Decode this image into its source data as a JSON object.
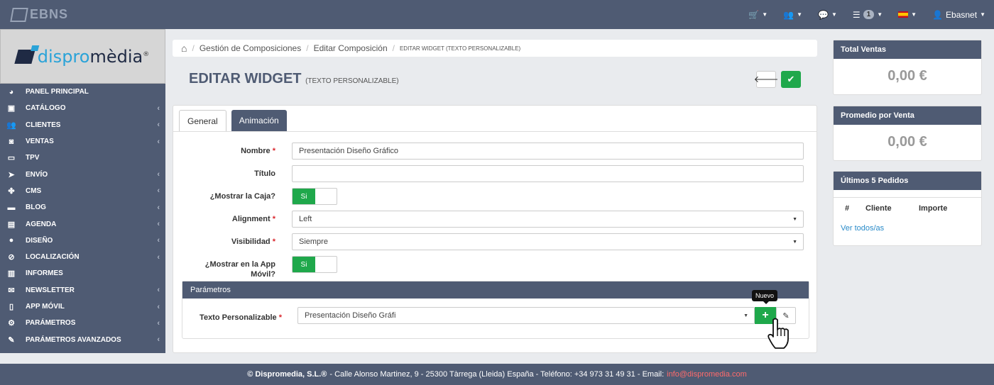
{
  "topbar": {
    "logo": "EBNS",
    "nav": [
      {
        "icon": "cart-icon",
        "glyph": "🛒"
      },
      {
        "icon": "users-icon",
        "glyph": "👥"
      },
      {
        "icon": "chat-icon",
        "glyph": "💬"
      },
      {
        "icon": "list-icon",
        "glyph": "☰",
        "badge": "1"
      },
      {
        "icon": "flag-es-icon"
      },
      {
        "icon": "user-icon",
        "glyph": "👤",
        "label": "Ebasnet"
      }
    ]
  },
  "brand": {
    "name_pre": "dispro",
    "name_post": "mèdia",
    "reg": "®"
  },
  "sidebar": {
    "items": [
      {
        "label": "PANEL PRINCIPAL",
        "glyph": "◕",
        "icon": "dashboard-icon",
        "chevron": false
      },
      {
        "label": "CATÁLOGO",
        "glyph": "▣",
        "icon": "box-icon",
        "chevron": true
      },
      {
        "label": "CLIENTES",
        "glyph": "👥",
        "icon": "users-icon",
        "chevron": true
      },
      {
        "label": "VENTAS",
        "glyph": "◙",
        "icon": "money-icon",
        "chevron": true
      },
      {
        "label": "TPV",
        "glyph": "▭",
        "icon": "card-icon",
        "chevron": false
      },
      {
        "label": "ENVÍO",
        "glyph": "➤",
        "icon": "send-icon",
        "chevron": true
      },
      {
        "label": "CMS",
        "glyph": "✤",
        "icon": "cubes-icon",
        "chevron": true
      },
      {
        "label": "BLOG",
        "glyph": "▬",
        "icon": "coffee-icon",
        "chevron": true
      },
      {
        "label": "AGENDA",
        "glyph": "▤",
        "icon": "calendar-icon",
        "chevron": true
      },
      {
        "label": "DISEÑO",
        "glyph": "●",
        "icon": "drop-icon",
        "chevron": true
      },
      {
        "label": "LOCALIZACIÓN",
        "glyph": "⊘",
        "icon": "compass-icon",
        "chevron": true
      },
      {
        "label": "INFORMES",
        "glyph": "▥",
        "icon": "chart-icon",
        "chevron": false
      },
      {
        "label": "NEWSLETTER",
        "glyph": "✉",
        "icon": "envelope-icon",
        "chevron": true
      },
      {
        "label": "APP MÓVIL",
        "glyph": "▯",
        "icon": "mobile-icon",
        "chevron": true
      },
      {
        "label": "PARÁMETROS",
        "glyph": "⚙",
        "icon": "cogs-icon",
        "chevron": true
      },
      {
        "label": "PARÁMETROS AVANZADOS",
        "glyph": "✎",
        "icon": "wrench-icon",
        "chevron": true
      }
    ]
  },
  "breadcrumb": {
    "home_glyph": "⌂",
    "items": [
      "Gestión de Composiciones",
      "Editar Composición"
    ],
    "current": "EDITAR WIDGET (TEXTO PERSONALIZABLE)"
  },
  "page": {
    "title": "EDITAR WIDGET",
    "subtitle": "(TEXTO PERSONALIZABLE)"
  },
  "tabs": [
    "General",
    "Animación"
  ],
  "form": {
    "nombre": {
      "label": "Nombre",
      "value": "Presentación Diseño Gráfico"
    },
    "titulo": {
      "label": "Título",
      "value": ""
    },
    "mostrar_caja": {
      "label": "¿Mostrar la Caja?",
      "value": "Si"
    },
    "alignment": {
      "label": "Alignment",
      "value": "Left"
    },
    "visibilidad": {
      "label": "Visibilidad",
      "value": "Siempre"
    },
    "app_movil": {
      "label_1": "¿Mostrar en la App",
      "label_2": "Móvil?",
      "value": "Si"
    }
  },
  "params": {
    "title": "Parámetros",
    "texto_label": "Texto Personalizable",
    "texto_value": "Presentación Diseño Gráfi",
    "tooltip": "Nuevo"
  },
  "right": {
    "total_ventas": {
      "title": "Total Ventas",
      "value": "0,00 €"
    },
    "promedio": {
      "title": "Promedio por Venta",
      "value": "0,00 €"
    },
    "pedidos": {
      "title": "Últimos 5 Pedidos",
      "cols": [
        "#",
        "Cliente",
        "Importe"
      ],
      "link": "Ver todos/as"
    }
  },
  "footer": {
    "company": "© Dispromedia, S.L.®",
    "text": "- Calle Alonso Martinez, 9 - 25300 Tàrrega (Lleida) España - Teléfono: +34 973 31 49 31 - Email:",
    "email": "info@dispromedia.com"
  },
  "colors": {
    "navy": "#4f5b73",
    "green": "#1fa84b",
    "required": "#d9262c"
  }
}
